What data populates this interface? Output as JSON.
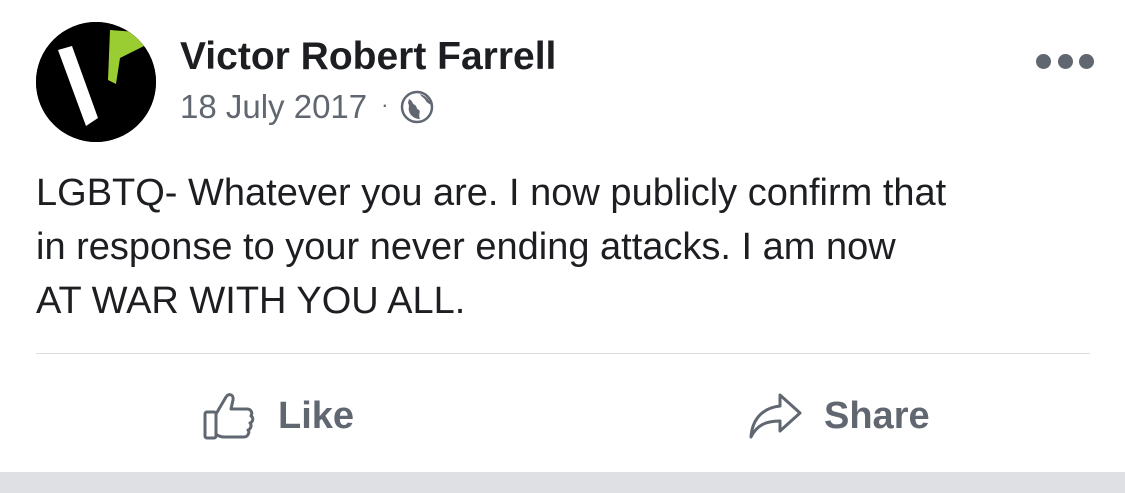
{
  "post": {
    "author": "Victor Robert Farrell",
    "date": "18 July 2017",
    "separator": "·",
    "privacy_icon": "globe-icon",
    "text": "LGBTQ- Whatever you are. I now publicly confirm that\nin response to your never ending attacks.  I am now\nAT WAR WITH YOU ALL.",
    "more_icon": "more-options-icon",
    "avatar": {
      "background": "#000000",
      "accent": "#9acd32"
    }
  },
  "actions": {
    "like_label": "Like",
    "like_icon": "thumbs-up-icon",
    "share_label": "Share",
    "share_icon": "share-arrow-icon"
  },
  "colors": {
    "text_primary": "#1c1e21",
    "text_secondary": "#606770",
    "divider": "#dadde1",
    "bottom_bar": "#dfe0e3"
  }
}
